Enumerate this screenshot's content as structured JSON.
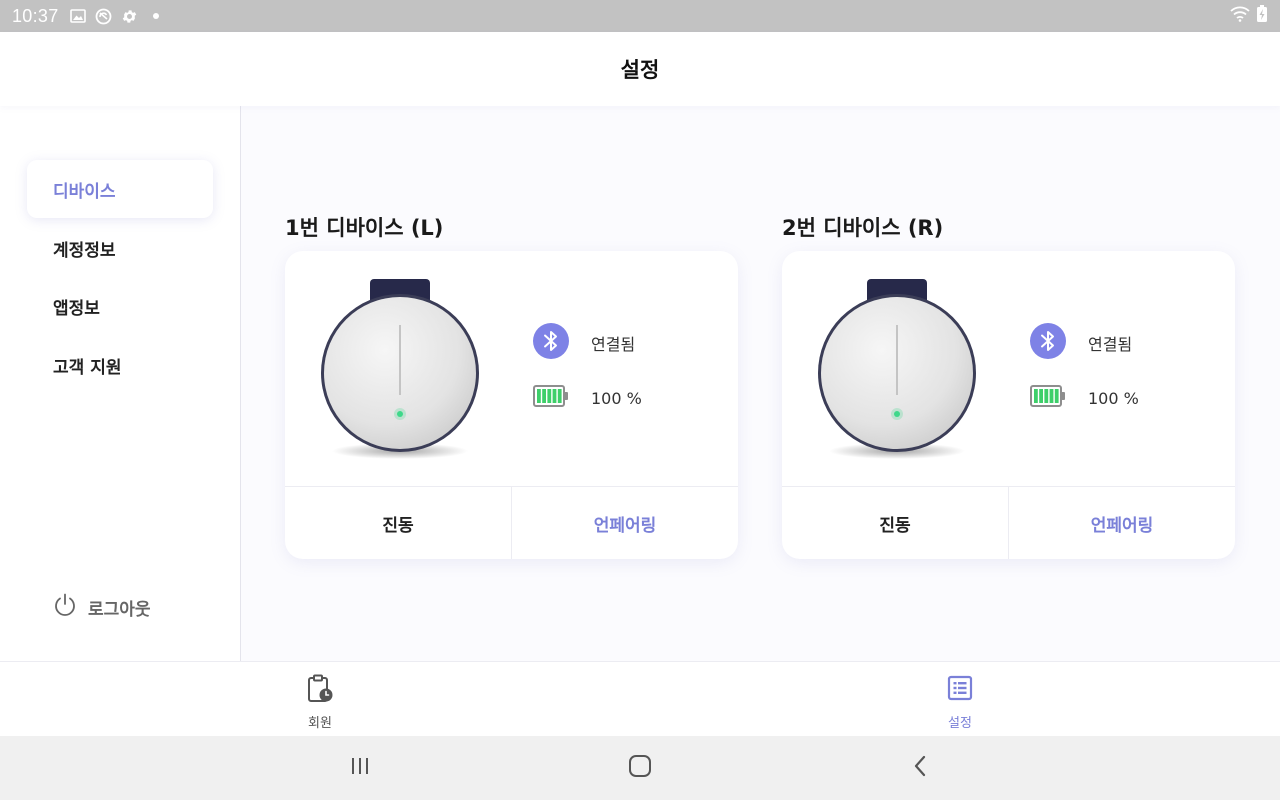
{
  "status_bar": {
    "time": "10:37",
    "icons": [
      "gallery-icon",
      "sync-icon",
      "gear-icon",
      "dot-icon"
    ],
    "right_icons": [
      "wifi-icon",
      "battery-charging-icon"
    ]
  },
  "header": {
    "title": "설정"
  },
  "sidebar": {
    "items": [
      {
        "label": "디바이스",
        "active": true
      },
      {
        "label": "계정정보",
        "active": false
      },
      {
        "label": "앱정보",
        "active": false
      },
      {
        "label": "고객 지원",
        "active": false
      }
    ],
    "logout_label": "로그아웃"
  },
  "devices": [
    {
      "title": "1번 디바이스 (L)",
      "connection_status": "연결됨",
      "battery_text": "100 %",
      "battery_level": 1.0,
      "vibrate_label": "진동",
      "unpair_label": "언페어링"
    },
    {
      "title": "2번 디바이스 (R)",
      "connection_status": "연결됨",
      "battery_text": "100 %",
      "battery_level": 1.0,
      "vibrate_label": "진동",
      "unpair_label": "언페어링"
    }
  ],
  "bottom_nav": {
    "items": [
      {
        "label": "회원",
        "icon": "clipboard-clock-icon",
        "active": false
      },
      {
        "label": "설정",
        "icon": "list-icon",
        "active": true
      }
    ]
  },
  "colors": {
    "accent": "#7a80d8",
    "bluetooth": "#7e82e6",
    "battery": "#3ecf6a",
    "led": "#3ed98a"
  }
}
